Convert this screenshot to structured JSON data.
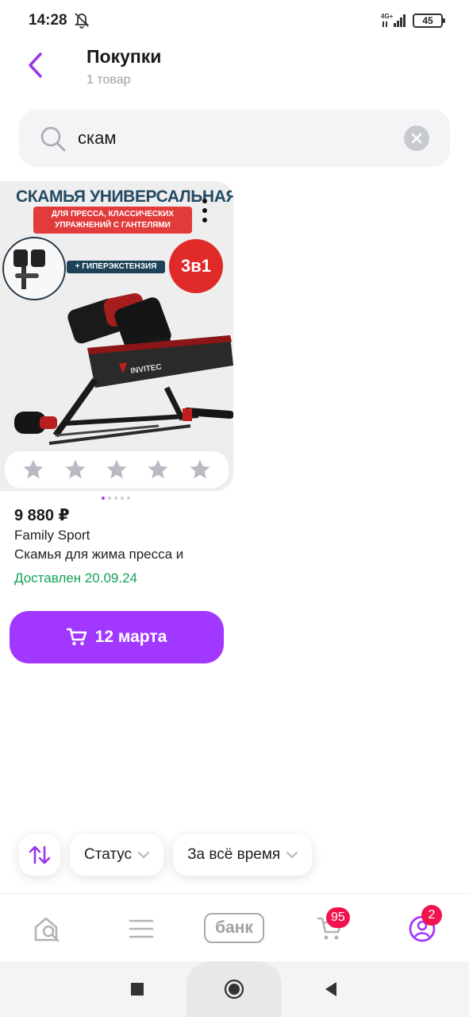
{
  "status_bar": {
    "time": "14:28",
    "network": "4G+",
    "battery": "45"
  },
  "header": {
    "title": "Покупки",
    "subtitle": "1 товар"
  },
  "search": {
    "value": "скам"
  },
  "product": {
    "image": {
      "headline": "СКАМЬЯ УНИВЕРСАЛЬНАЯ",
      "subbanner": "ДЛЯ ПРЕССА, КЛАССИЧЕСКИХ УПРАЖНЕНИЙ С ГАНТЕЛЯМИ",
      "hyper_tag": "+ ГИПЕРЭКСТЕНЗИЯ",
      "badge": "3в1",
      "brand_mark": "INVITEC"
    },
    "rating_stars": 5,
    "price": "9 880 ₽",
    "brand": "Family Sport",
    "name": "Скамья для жима пресса и",
    "delivery_status": "Доставлен 20.09.24"
  },
  "buy_button": {
    "label": "12 марта"
  },
  "filters": {
    "status": "Статус",
    "period": "За всё время"
  },
  "bottom_nav": {
    "bank_label": "банк",
    "cart_badge": "95",
    "profile_badge": "2"
  },
  "colors": {
    "accent": "#a238ff",
    "delivered": "#15a15a",
    "badge": "#f0134d"
  }
}
